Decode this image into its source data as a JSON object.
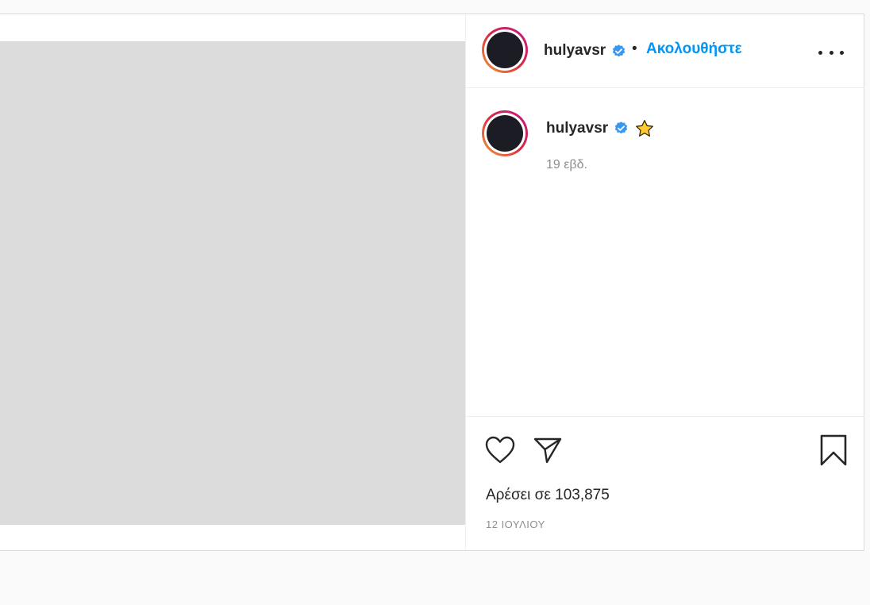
{
  "post": {
    "username": "hulyavsr",
    "follow_label": "Ακολουθήστε",
    "separator": "•",
    "caption_emoji": "⭐",
    "time_ago": "19 εβδ.",
    "likes_text": "Αρέσει σε 103,875",
    "date": "12 ΙΟΥΛΙΟΥ"
  },
  "icons": {
    "verified": "verified-badge-icon",
    "more": "more-options-icon",
    "like": "heart-icon",
    "share": "paper-plane-icon",
    "save": "bookmark-icon"
  },
  "colors": {
    "accent": "#0095f6",
    "verified": "#3897f0",
    "text": "#262626",
    "muted": "#8e8e8e"
  }
}
